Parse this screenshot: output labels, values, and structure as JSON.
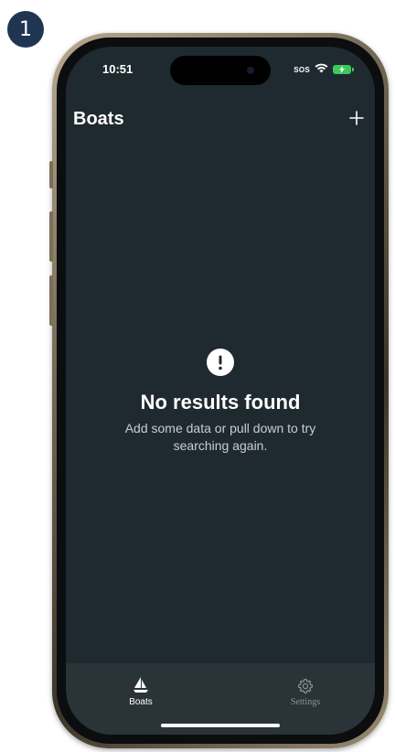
{
  "step_badge": "1",
  "status_bar": {
    "time": "10:51",
    "sos": "SOS",
    "icons": [
      "wifi-icon",
      "battery-charging-icon"
    ]
  },
  "header": {
    "title": "Boats",
    "add_icon": "plus-icon"
  },
  "empty_state": {
    "icon": "exclamation-circle-icon",
    "title": "No results found",
    "message": "Add some data or pull down to try searching again."
  },
  "tab_bar": {
    "items": [
      {
        "label": "Boats",
        "icon": "sailboat-icon",
        "active": true
      },
      {
        "label": "Settings",
        "icon": "gear-icon",
        "active": false
      }
    ]
  },
  "colors": {
    "screen_background": "#1f2a30",
    "tab_bar_background": "#2a3438",
    "badge_background": "#1f3552",
    "battery": "#3ec95c"
  }
}
